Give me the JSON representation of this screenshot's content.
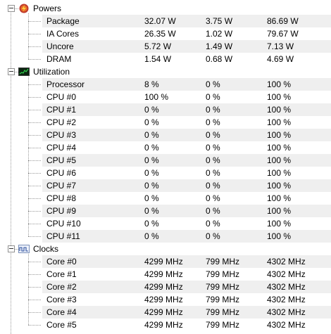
{
  "groups": [
    {
      "label": "Powers",
      "icon": "flame-power-icon",
      "rows": [
        {
          "name": "Package",
          "current": "32.07 W",
          "min": "3.75 W",
          "max": "86.69 W"
        },
        {
          "name": "IA Cores",
          "current": "26.35 W",
          "min": "1.02 W",
          "max": "79.67 W"
        },
        {
          "name": "Uncore",
          "current": "5.72 W",
          "min": "1.49 W",
          "max": "7.13 W"
        },
        {
          "name": "DRAM",
          "current": "1.54 W",
          "min": "0.68 W",
          "max": "4.69 W"
        }
      ]
    },
    {
      "label": "Utilization",
      "icon": "utilization-monitor-icon",
      "rows": [
        {
          "name": "Processor",
          "current": "8 %",
          "min": "0 %",
          "max": "100 %"
        },
        {
          "name": "CPU #0",
          "current": "100 %",
          "min": "0 %",
          "max": "100 %"
        },
        {
          "name": "CPU #1",
          "current": "0 %",
          "min": "0 %",
          "max": "100 %"
        },
        {
          "name": "CPU #2",
          "current": "0 %",
          "min": "0 %",
          "max": "100 %"
        },
        {
          "name": "CPU #3",
          "current": "0 %",
          "min": "0 %",
          "max": "100 %"
        },
        {
          "name": "CPU #4",
          "current": "0 %",
          "min": "0 %",
          "max": "100 %"
        },
        {
          "name": "CPU #5",
          "current": "0 %",
          "min": "0 %",
          "max": "100 %"
        },
        {
          "name": "CPU #6",
          "current": "0 %",
          "min": "0 %",
          "max": "100 %"
        },
        {
          "name": "CPU #7",
          "current": "0 %",
          "min": "0 %",
          "max": "100 %"
        },
        {
          "name": "CPU #8",
          "current": "0 %",
          "min": "0 %",
          "max": "100 %"
        },
        {
          "name": "CPU #9",
          "current": "0 %",
          "min": "0 %",
          "max": "100 %"
        },
        {
          "name": "CPU #10",
          "current": "0 %",
          "min": "0 %",
          "max": "100 %"
        },
        {
          "name": "CPU #11",
          "current": "0 %",
          "min": "0 %",
          "max": "100 %"
        }
      ]
    },
    {
      "label": "Clocks",
      "icon": "clock-wave-icon",
      "rows": [
        {
          "name": "Core #0",
          "current": "4299 MHz",
          "min": "799 MHz",
          "max": "4302 MHz"
        },
        {
          "name": "Core #1",
          "current": "4299 MHz",
          "min": "799 MHz",
          "max": "4302 MHz"
        },
        {
          "name": "Core #2",
          "current": "4299 MHz",
          "min": "799 MHz",
          "max": "4302 MHz"
        },
        {
          "name": "Core #3",
          "current": "4299 MHz",
          "min": "799 MHz",
          "max": "4302 MHz"
        },
        {
          "name": "Core #4",
          "current": "4299 MHz",
          "min": "799 MHz",
          "max": "4302 MHz"
        },
        {
          "name": "Core #5",
          "current": "4299 MHz",
          "min": "799 MHz",
          "max": "4302 MHz"
        }
      ]
    }
  ],
  "colors": {
    "alt_row": "#efefef",
    "tree_line": "#9a9a9a"
  }
}
